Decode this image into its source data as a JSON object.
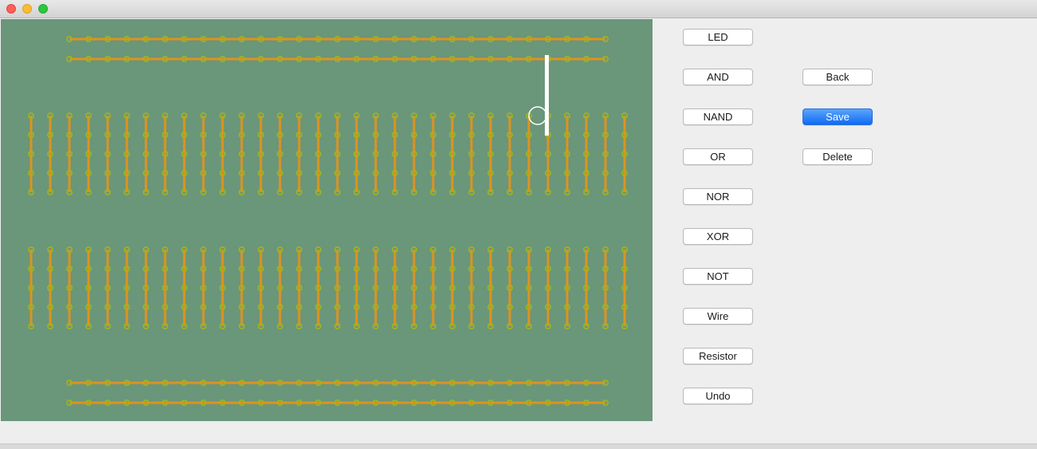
{
  "window": {
    "title": "",
    "controls": [
      "close-icon",
      "minimize-icon",
      "maximize-icon"
    ]
  },
  "board": {
    "background_color": "#6a9679",
    "rail_color": "#e0921e",
    "hole_color": "#9fb521",
    "top_rails": 2,
    "bottom_rails": 2,
    "rail_holes": 29,
    "columns_per_block": 32,
    "holes_per_column": 5,
    "wire_color": "#ffffff"
  },
  "components": {
    "led_label": "LED",
    "and_label": "AND",
    "nand_label": "NAND",
    "or_label": "OR",
    "nor_label": "NOR",
    "xor_label": "XOR",
    "not_label": "NOT",
    "wire_label": "Wire",
    "resistor_label": "Resistor",
    "undo_label": "Undo"
  },
  "actions": {
    "back_label": "Back",
    "save_label": "Save",
    "delete_label": "Delete"
  },
  "accent_color": "#1069f3"
}
